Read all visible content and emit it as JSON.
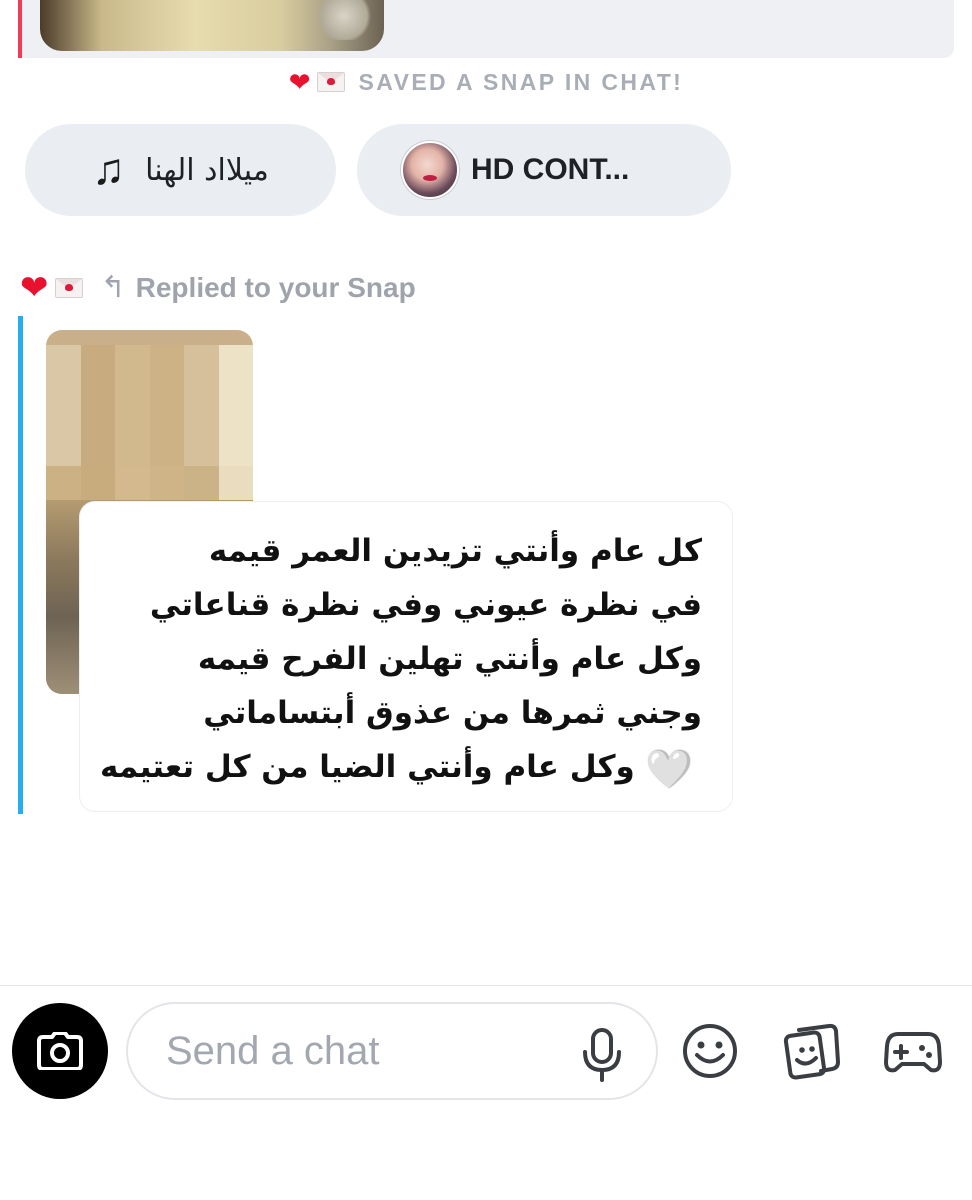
{
  "status": {
    "saved_text": "SAVED A SNAP IN CHAT!"
  },
  "attachments": {
    "music_label": "ميلااد الهنا",
    "contact_label": "HD CONT..."
  },
  "reply": {
    "label": "Replied to your Snap"
  },
  "message": {
    "lines": [
      "كل عام وأنتي تزيدين العمر قيمه",
      "في نظرة عيوني وفي نظرة قناعاتي",
      "وكل عام وأنتي تهلين الفرح قيمه",
      "وجني ثمرها من عذوق أبتساماتي",
      "وكل عام وأنتي الضيا من كل تعتيمه"
    ],
    "trailing_emoji": "🤍"
  },
  "composer": {
    "placeholder": "Send a chat"
  },
  "icons": {
    "heart": "❤",
    "music": "♫",
    "reply_arrow": "↰",
    "names": [
      "heart-icon",
      "envelope-icon",
      "music-note-icon",
      "reply-arrow-icon",
      "camera-icon",
      "microphone-icon",
      "emoji-icon",
      "sticker-icon",
      "game-controller-icon"
    ]
  },
  "colors": {
    "saved_accent": "#f23c57",
    "reply_accent": "#24aef0",
    "heart": "#e8122f",
    "muted_text": "#a8adb6"
  }
}
